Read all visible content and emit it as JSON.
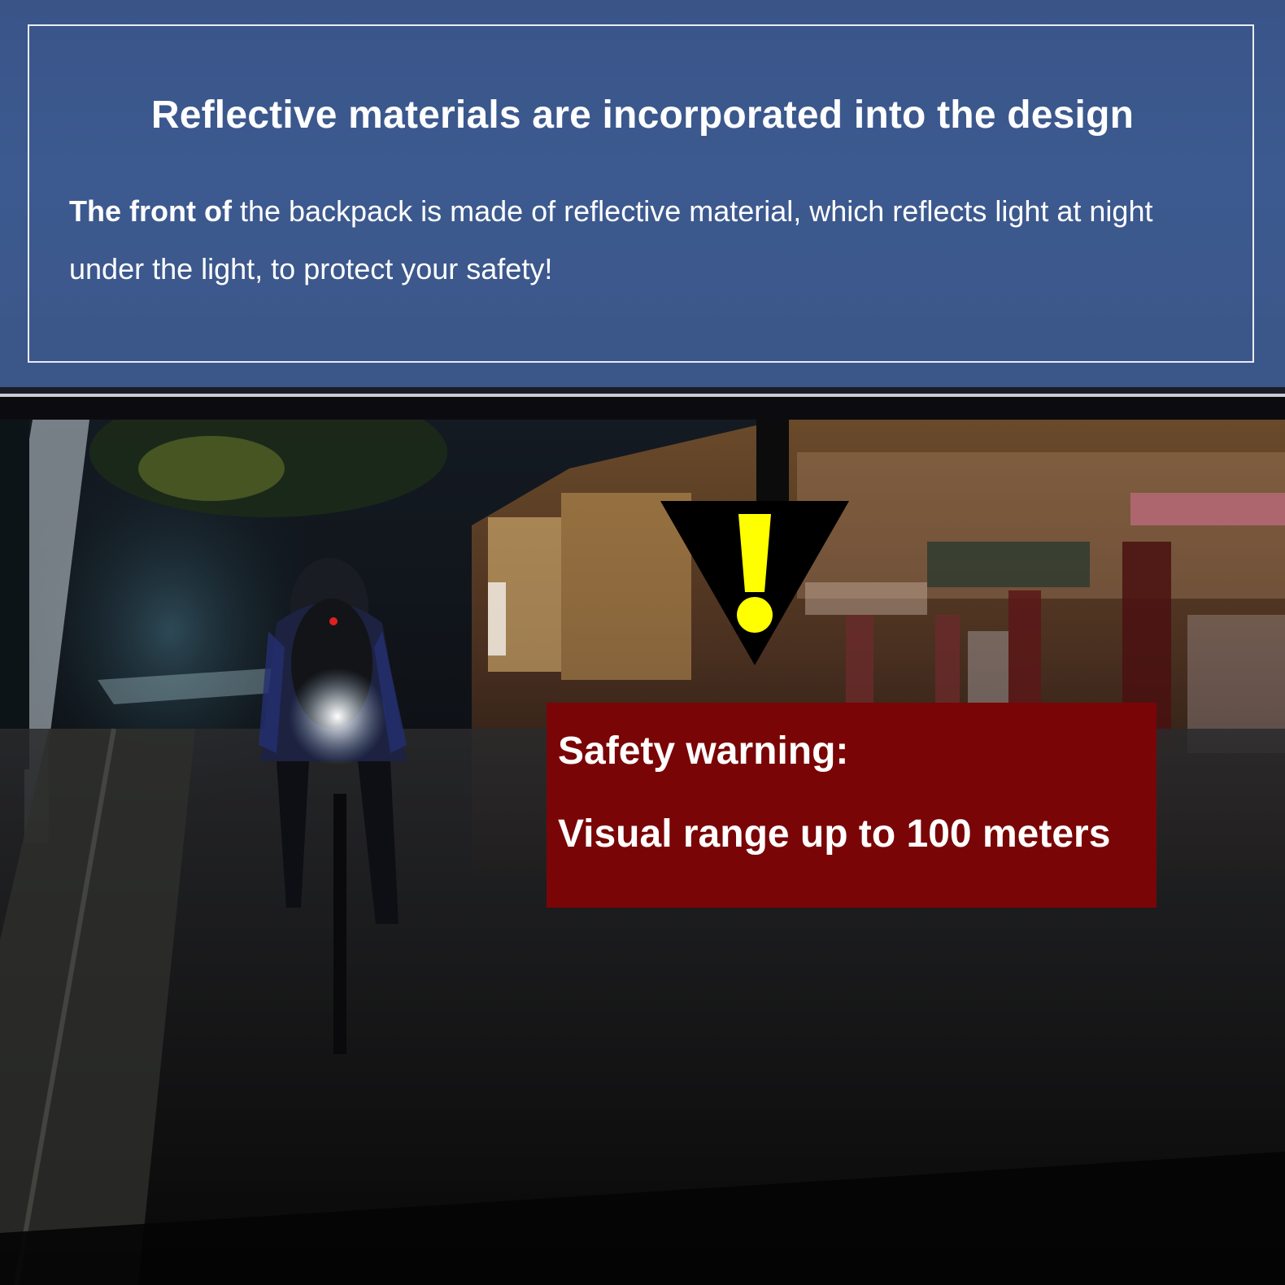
{
  "header": {
    "title": "Reflective materials are incorporated into the design",
    "description_lead": "The front of",
    "description_rest": " the backpack is made of reflective material, which reflects light at night under the light, to protect your safety!"
  },
  "warning": {
    "label": "Safety warning:",
    "detail": "Visual range up to 100 meters"
  },
  "colors": {
    "header_band": "#3c5a90",
    "warning_box": "#7a0506",
    "warning_symbol": "#ffff00"
  },
  "icons": {
    "warning_symbol": "warning-triangle-icon"
  }
}
